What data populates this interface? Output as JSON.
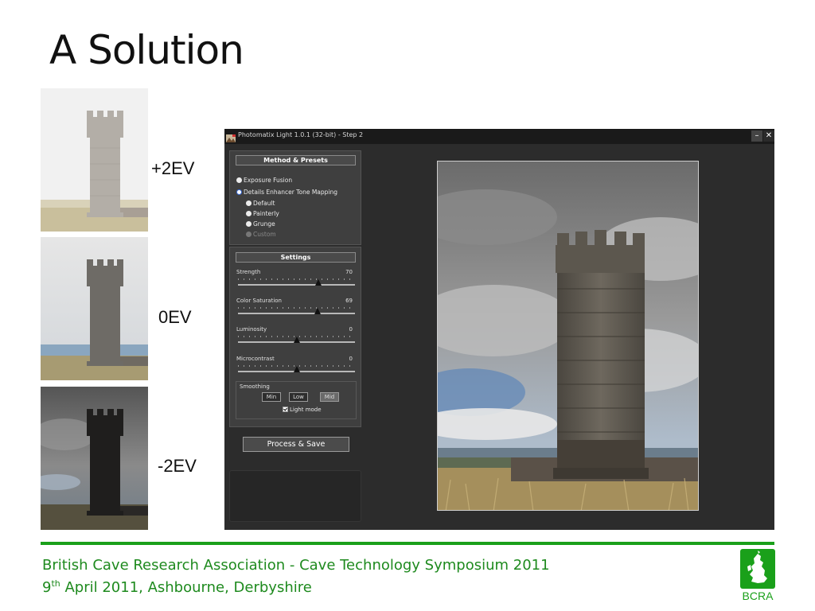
{
  "slide": {
    "title": "A Solution"
  },
  "exposures": [
    {
      "label": "+2EV"
    },
    {
      "label": "0EV"
    },
    {
      "label": "-2EV"
    }
  ],
  "app": {
    "title": "Photomatix Light 1.0.1 (32-bit) - Step 2",
    "window_buttons": {
      "minimize": "–",
      "close": "✕"
    },
    "method_panel": {
      "header": "Method & Presets",
      "methods": [
        "Exposure Fusion",
        "Details Enhancer Tone Mapping"
      ],
      "selected_method": "Details Enhancer Tone Mapping",
      "presets": [
        "Default",
        "Painterly",
        "Grunge",
        "Custom"
      ],
      "disabled_preset": "Custom"
    },
    "settings_panel": {
      "header": "Settings",
      "sliders": [
        {
          "label": "Strength",
          "value": 70,
          "position": 0.69
        },
        {
          "label": "Color Saturation",
          "value": 69,
          "position": 0.68
        },
        {
          "label": "Luminosity",
          "value": 0,
          "position": 0.5
        },
        {
          "label": "Microcontrast",
          "value": 0,
          "position": 0.5
        }
      ],
      "smoothing": {
        "title": "Smoothing",
        "options": [
          "Min",
          "Low",
          "Mid"
        ],
        "selected": "Mid"
      },
      "light_mode": {
        "label": "Light mode",
        "checked": true
      }
    },
    "process_button": "Process & Save"
  },
  "footer": {
    "line1": "British Cave Research Association -  Cave Technology Symposium 2011",
    "line2_day": "9",
    "line2_sup": "th",
    "line2_rest": " April 2011, Ashbourne, Derbyshire",
    "logo_text": "BCRA",
    "accent_color": "#1aa01a"
  }
}
